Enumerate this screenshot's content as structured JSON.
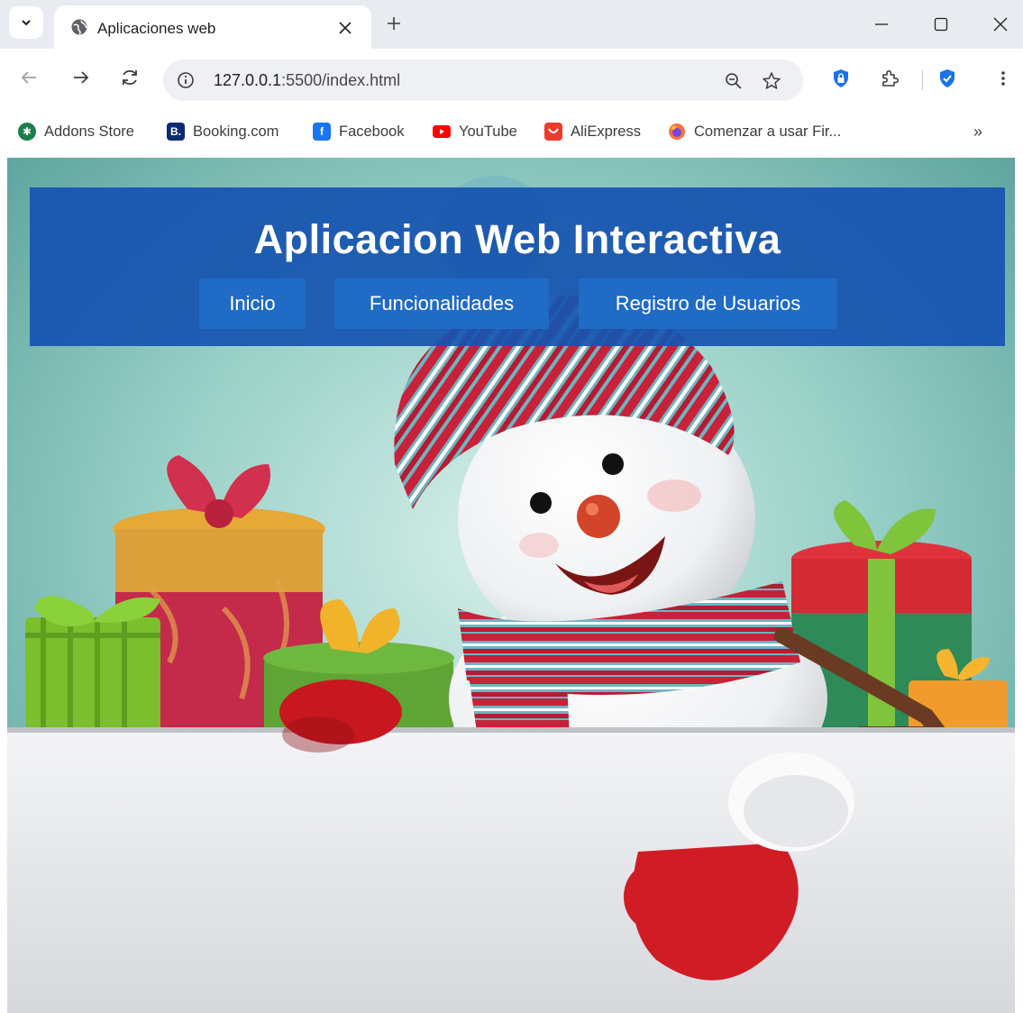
{
  "browser": {
    "tab_title": "Aplicaciones web",
    "url_host": "127.0.0.1",
    "url_rest": ":5500/index.html"
  },
  "bookmarks": [
    {
      "label": "Addons Store",
      "icon": "addons-store-icon",
      "color": "#1a7f4b"
    },
    {
      "label": "Booking.com",
      "icon": "booking-icon",
      "color": "#0b2b73"
    },
    {
      "label": "Facebook",
      "icon": "facebook-icon",
      "color": "#1877f2"
    },
    {
      "label": "YouTube",
      "icon": "youtube-icon",
      "color": "#ff0000"
    },
    {
      "label": "AliExpress",
      "icon": "aliexpress-icon",
      "color": "#ee3b2a"
    },
    {
      "label": "Comenzar a usar Fir...",
      "icon": "firefox-icon",
      "color": "#ff7139"
    }
  ],
  "page": {
    "title": "Aplicacion Web Interactiva",
    "nav": [
      "Inicio",
      "Funcionalidades",
      "Registro de Usuarios"
    ],
    "header_color": "#1554af",
    "nav_button_color": "#1f6bc6"
  }
}
